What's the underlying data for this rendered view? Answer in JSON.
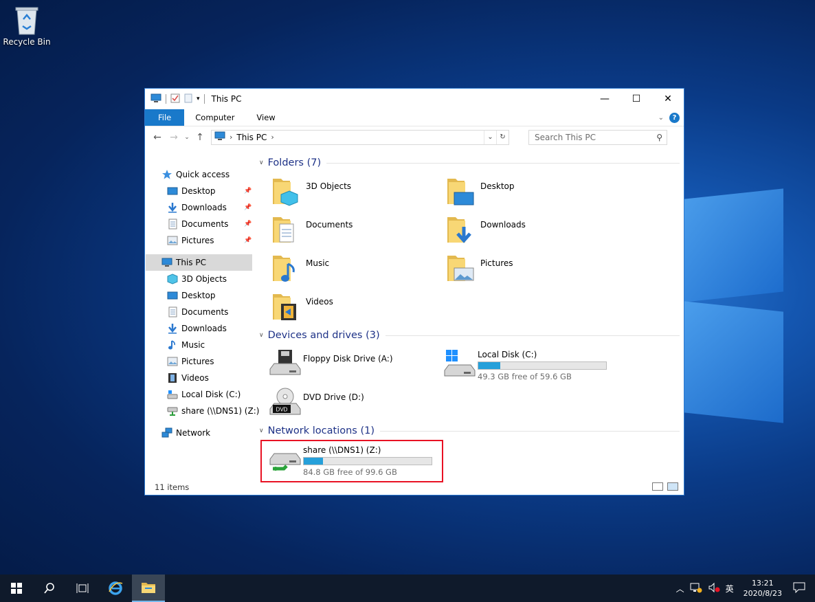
{
  "desktop": {
    "recycle_bin_label": "Recycle Bin"
  },
  "window": {
    "title": "This PC",
    "ribbon_tabs": [
      "File",
      "Computer",
      "View"
    ],
    "address_segments": [
      "This PC"
    ],
    "search_placeholder": "Search This PC",
    "nav": {
      "quick_access": "Quick access",
      "quick_items": [
        "Desktop",
        "Downloads",
        "Documents",
        "Pictures"
      ],
      "this_pc": "This PC",
      "pc_items": [
        "3D Objects",
        "Desktop",
        "Documents",
        "Downloads",
        "Music",
        "Pictures",
        "Videos",
        "Local Disk (C:)",
        "share (\\\\DNS1) (Z:)"
      ],
      "network": "Network"
    },
    "groups": {
      "folders": "Folders (7)",
      "devices": "Devices and drives (3)",
      "network": "Network locations (1)"
    },
    "folders": [
      "3D Objects",
      "Desktop",
      "Documents",
      "Downloads",
      "Music",
      "Pictures",
      "Videos"
    ],
    "drives": {
      "floppy": "Floppy Disk Drive (A:)",
      "local": {
        "name": "Local Disk (C:)",
        "free_text": "49.3 GB free of 59.6 GB",
        "used_fraction": 0.173
      },
      "dvd": "DVD Drive (D:)",
      "dvd_badge": "DVD"
    },
    "network_drive": {
      "name": "share (\\\\DNS1) (Z:)",
      "free_text": "84.8 GB free of 99.6 GB",
      "used_fraction": 0.149
    },
    "status": "11 items"
  },
  "taskbar": {
    "ime": "英",
    "time": "13:21",
    "date": "2020/8/23"
  },
  "colors": {
    "accent": "#1979ca",
    "bar_fill": "#26a0da",
    "highlight": "#e81123",
    "group_header": "#1e3287"
  }
}
